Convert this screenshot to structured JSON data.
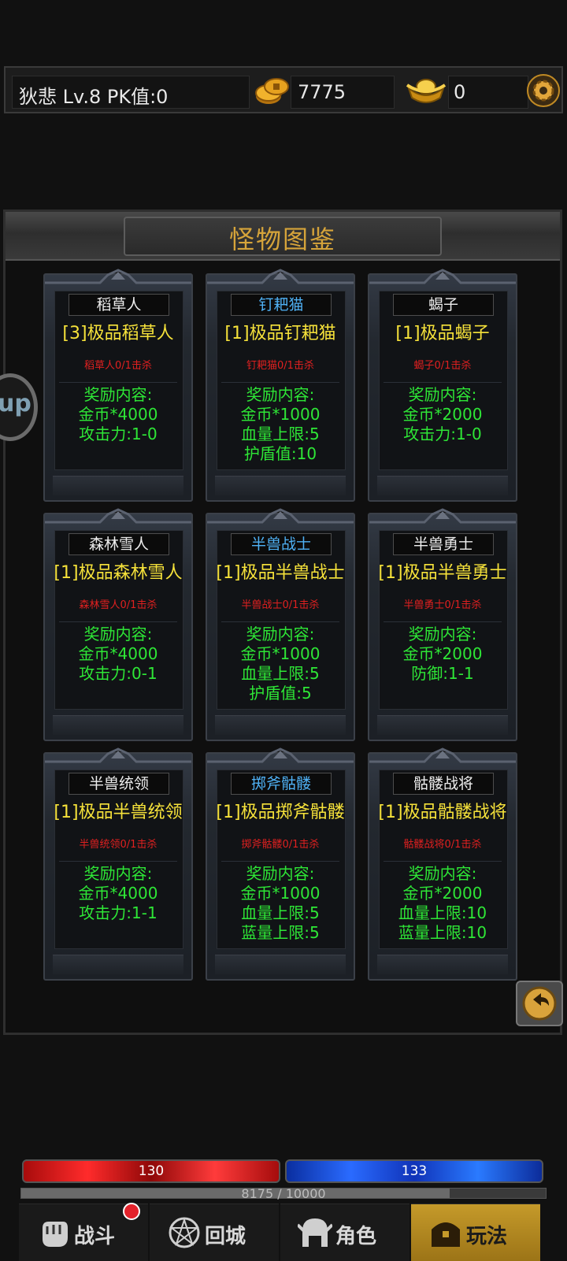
{
  "header": {
    "player": "狄悲  Lv.8 PK值:0",
    "gold": "7775",
    "ingot": "0"
  },
  "panel": {
    "title": "怪物图鉴"
  },
  "float_button": {
    "label": "up"
  },
  "cards": [
    {
      "name": "稻草人",
      "name_color": "white",
      "title": "[3]极品稻草人",
      "kill": "稻草人0/1击杀",
      "rewards": [
        "奖励内容:",
        "金币*4000",
        "攻击力:1-0"
      ]
    },
    {
      "name": "钉耙猫",
      "name_color": "blue",
      "title": "[1]极品钉耙猫",
      "kill": "钉耙猫0/1击杀",
      "rewards": [
        "奖励内容:",
        "金币*1000",
        "血量上限:5",
        "护盾值:10"
      ]
    },
    {
      "name": "蝎子",
      "name_color": "white",
      "title": "[1]极品蝎子",
      "kill": "蝎子0/1击杀",
      "rewards": [
        "奖励内容:",
        "金币*2000",
        "攻击力:1-0"
      ]
    },
    {
      "name": "森林雪人",
      "name_color": "white",
      "title": "[1]极品森林雪人",
      "kill": "森林雪人0/1击杀",
      "rewards": [
        "奖励内容:",
        "金币*4000",
        "攻击力:0-1"
      ]
    },
    {
      "name": "半兽战士",
      "name_color": "blue",
      "title": "[1]极品半兽战士",
      "kill": "半兽战士0/1击杀",
      "rewards": [
        "奖励内容:",
        "金币*1000",
        "血量上限:5",
        "护盾值:5"
      ]
    },
    {
      "name": "半兽勇士",
      "name_color": "white",
      "title": "[1]极品半兽勇士",
      "kill": "半兽勇士0/1击杀",
      "rewards": [
        "奖励内容:",
        "金币*2000",
        "防御:1-1"
      ]
    },
    {
      "name": "半兽统领",
      "name_color": "white",
      "title": "[1]极品半兽统领",
      "kill": "半兽统领0/1击杀",
      "rewards": [
        "奖励内容:",
        "金币*4000",
        "攻击力:1-1"
      ]
    },
    {
      "name": "掷斧骷髅",
      "name_color": "blue",
      "title": "[1]极品掷斧骷髅",
      "kill": "掷斧骷髅0/1击杀",
      "rewards": [
        "奖励内容:",
        "金币*1000",
        "血量上限:5",
        "蓝量上限:5"
      ]
    },
    {
      "name": "骷髅战将",
      "name_color": "white",
      "title": "[1]极品骷髅战将",
      "kill": "骷髅战将0/1击杀",
      "rewards": [
        "奖励内容:",
        "金币*2000",
        "血量上限:10",
        "蓝量上限:10"
      ]
    }
  ],
  "status": {
    "hp": "130",
    "mp": "133",
    "exp": "8175 / 10000",
    "exp_fraction": 0.8175
  },
  "nav": [
    {
      "label": "战斗",
      "icon": "fist-icon",
      "badge": true,
      "active": false
    },
    {
      "label": "回城",
      "icon": "portal-icon",
      "badge": false,
      "active": false
    },
    {
      "label": "角色",
      "icon": "helmet-icon",
      "badge": false,
      "active": false
    },
    {
      "label": "玩法",
      "icon": "chest-icon",
      "badge": false,
      "active": true
    }
  ],
  "colors": {
    "title_gold": "#d6a43a",
    "monster_title": "#f6e23a",
    "reward_green": "#2ee636",
    "kill_red": "#e02020",
    "name_blue": "#4fb1f5"
  }
}
